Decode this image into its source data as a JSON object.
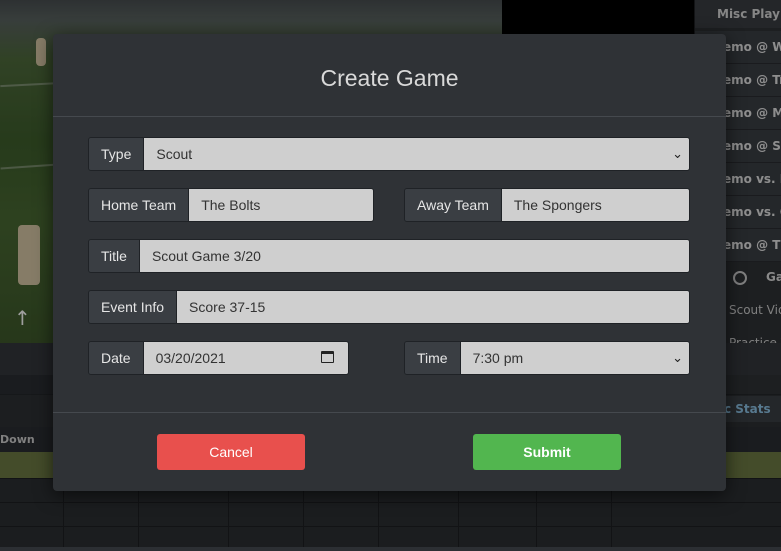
{
  "background": {
    "playlist_header": "Misc Playlis",
    "playlist_items": [
      "emo @ We",
      "emo @ Tr",
      "emo @ Ma",
      "emo @ St",
      "emo vs. P",
      "emo vs. G",
      "emo @ Th"
    ],
    "radio_label": "Ga",
    "links": [
      "Scout Vide",
      "Practice V"
    ],
    "stats_tab": "c Stats",
    "down_label": "Down"
  },
  "modal": {
    "title": "Create Game",
    "type_label": "Type",
    "type_value": "Scout",
    "home_label": "Home Team",
    "home_value": "The Bolts",
    "away_label": "Away Team",
    "away_value": "The Spongers",
    "title_label": "Title",
    "title_value": "Scout Game 3/20",
    "event_label": "Event Info",
    "event_value": "Score 37-15",
    "date_label": "Date",
    "date_value": "03/20/2021",
    "time_label": "Time",
    "time_value": "7:30 pm",
    "cancel_label": "Cancel",
    "submit_label": "Submit"
  },
  "colors": {
    "cancel": "#e8504d",
    "submit": "#52b64f",
    "modal_bg": "#2f3236"
  }
}
